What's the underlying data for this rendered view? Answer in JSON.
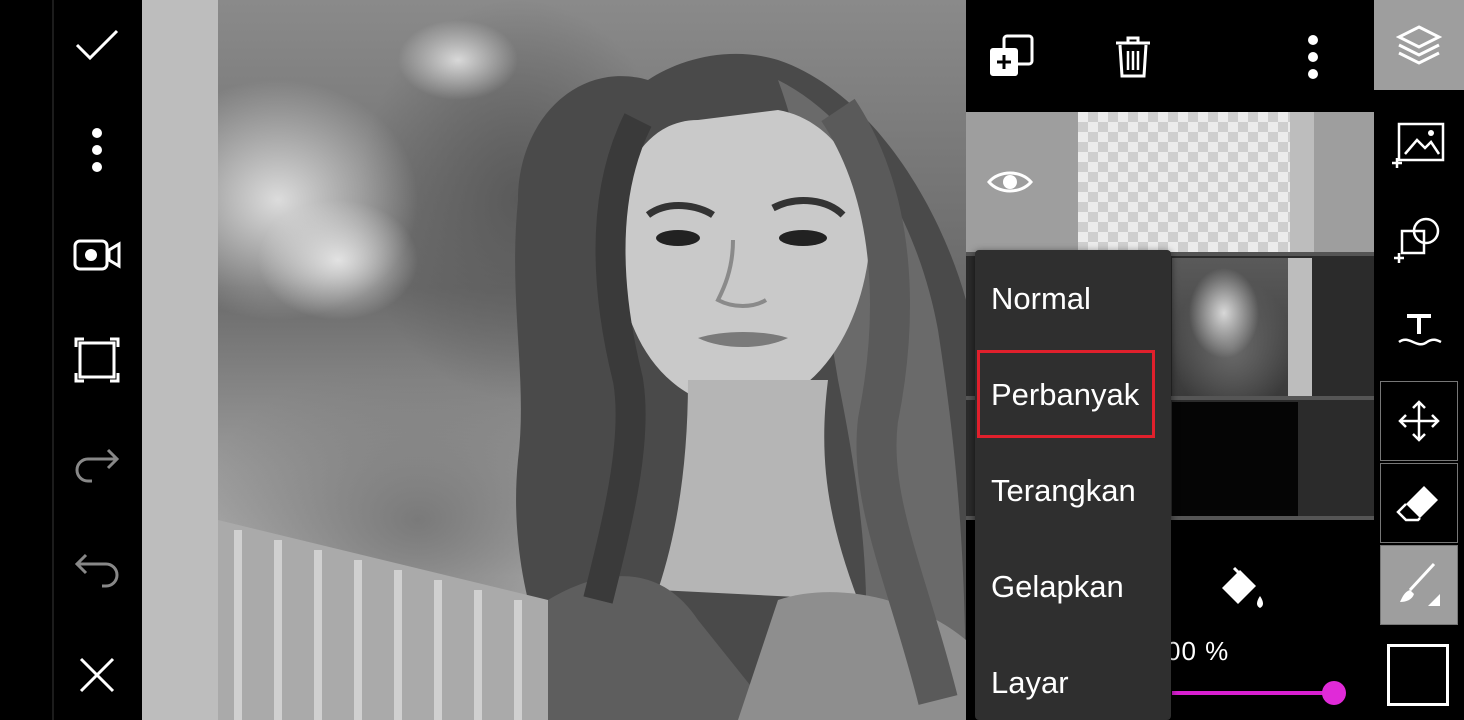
{
  "blend_menu": {
    "items": [
      "Normal",
      "Perbanyak",
      "Terangkan",
      "Gelapkan",
      "Layar"
    ],
    "selected": "Perbanyak"
  },
  "layers_panel": {
    "opacity_label": "00 %",
    "opacity_value": 100
  },
  "colors": {
    "accent": "#d81fd0",
    "selection_outline": "#e0202c",
    "panel_bg": "#2f2f2f",
    "active_tool_bg": "#9e9e9e"
  },
  "icons": {
    "left_toolbar": [
      "check-icon",
      "more-vertical-icon",
      "video-camera-icon",
      "crop-frame-icon",
      "redo-icon",
      "undo-icon",
      "close-icon"
    ],
    "layers_toolbar": [
      "add-layer-icon",
      "trash-icon",
      "more-vertical-icon"
    ],
    "right_toolbar": [
      "layers-icon",
      "add-image-icon",
      "add-shape-icon",
      "text-icon",
      "move-icon",
      "eraser-icon",
      "brush-icon"
    ]
  }
}
